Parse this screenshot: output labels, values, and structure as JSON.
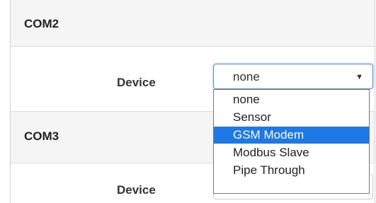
{
  "com2": {
    "title": "COM2",
    "device_label": "Device",
    "device_value": "none"
  },
  "com3": {
    "title": "COM3",
    "device_label": "Device"
  },
  "dropdown": {
    "options": [
      "none",
      "Sensor",
      "GSM Modem",
      "Modbus Slave",
      "Pipe Through"
    ],
    "highlighted": "GSM Modem"
  },
  "colors": {
    "highlight": "#1e78e6",
    "focus_border": "#4d90d6"
  }
}
